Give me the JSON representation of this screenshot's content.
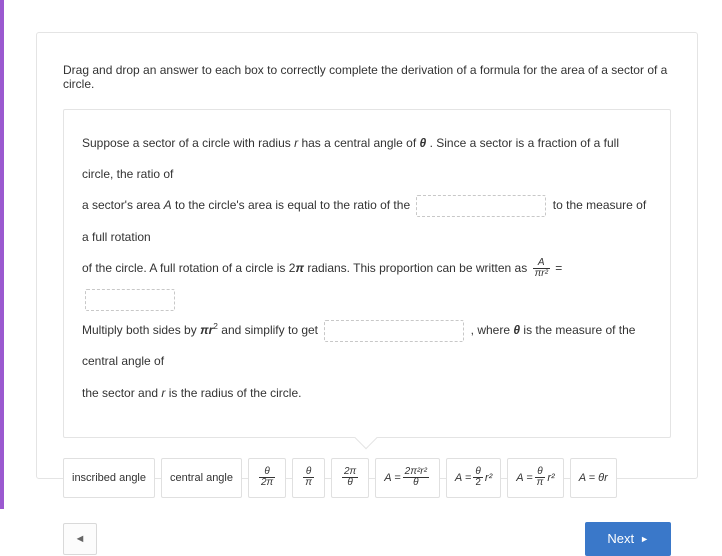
{
  "prompt": "Drag and drop an answer to each box to correctly complete the derivation of a formula for the area of a sector of a circle.",
  "passage": {
    "p1a": "Suppose a sector of a circle with radius ",
    "r": "r",
    "p1b": " has a central angle of  ",
    "theta1": "θ",
    "p1c": " . Since a sector is a fraction of a full circle, the ratio of",
    "p2a": "a sector's area ",
    "A": "A",
    "p2b": " to the circle's area is equal to the ratio of the ",
    "p2c": " to the measure of a full rotation",
    "p3a": "of the circle. A full rotation of a circle is  2",
    "pi1": "π",
    "p3b": "  radians. This proportion can be written as  ",
    "frac_eq_num": "A",
    "frac_eq_den": "πr²",
    "eq": " = ",
    "p4a": "Multiply both sides by  ",
    "pi2": "π",
    "r2": "r",
    "sq": "2",
    "p4b": "  and simplify to get ",
    "p4c": " , where  ",
    "theta2": "θ",
    "p4d": "  is the measure of the central angle of",
    "p5": "the sector and ",
    "r3": "r",
    "p5b": " is the radius of the circle."
  },
  "tiles": {
    "t1": "inscribed angle",
    "t2": "central angle",
    "t3_num": "θ",
    "t3_den": "2π",
    "t4_num": "θ",
    "t4_den": "π",
    "t5_num": "2π",
    "t5_den": "θ",
    "t6_pre": "A = ",
    "t6_num": "2π²r²",
    "t6_den": "θ",
    "t7_pre": "A = ",
    "t7_num": "θ",
    "t7_den": "2",
    "t7_post": "r²",
    "t8_pre": "A = ",
    "t8_num": "θ",
    "t8_den": "π",
    "t8_post": "r²",
    "t9": "A = θr"
  },
  "nav": {
    "prev": "◄",
    "next": "Next",
    "next_arrow": "►"
  },
  "chart_data": null
}
